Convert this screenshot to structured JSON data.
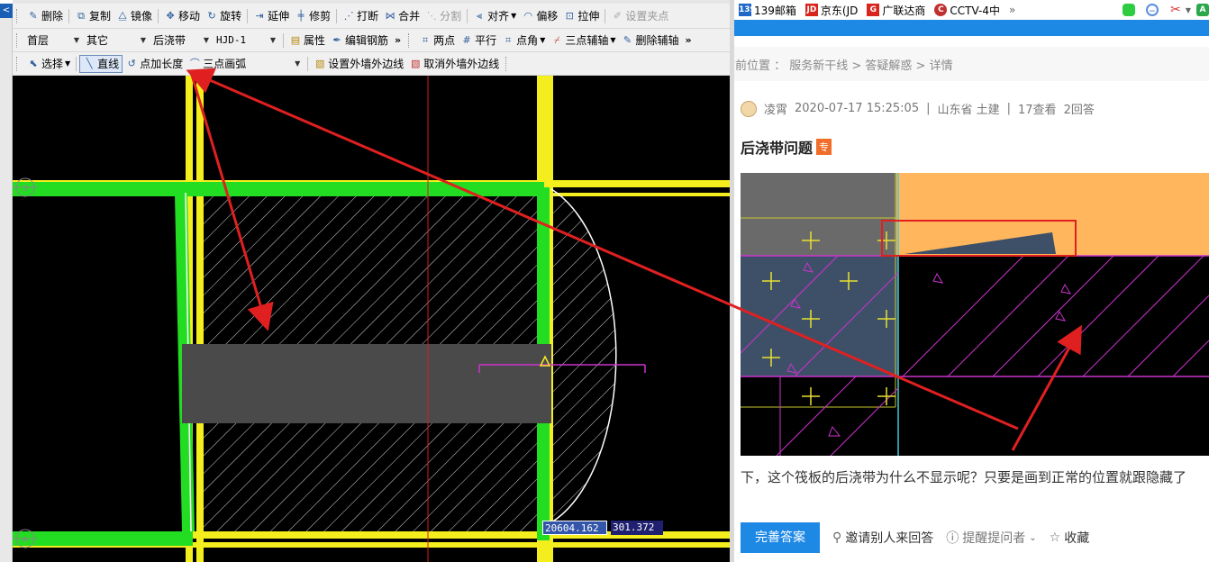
{
  "cad": {
    "left_tab": "<",
    "toolbar1": {
      "delete": "删除",
      "copy": "复制",
      "mirror": "镜像",
      "move": "移动",
      "rotate": "旋转",
      "extend": "延伸",
      "trim": "修剪",
      "break": "打断",
      "merge": "合并",
      "split": "分割",
      "align": "对齐",
      "offset": "偏移",
      "stretch": "拉伸",
      "set_grip": "设置夹点"
    },
    "toolbar2": {
      "floor": "首层",
      "category": "其它",
      "element_type": "后浇带",
      "element_name": "HJD-1",
      "properties": "属性",
      "edit_rebar": "编辑钢筋",
      "two_points": "两点",
      "parallel": "平行",
      "point_angle": "点角",
      "three_point_axis": "三点辅轴",
      "delete_axis": "删除辅轴"
    },
    "toolbar3": {
      "select": "选择",
      "line": "直线",
      "point_length": "点加长度",
      "three_point_arc": "三点画弧",
      "set_outer_edge": "设置外墙外边线",
      "cancel_outer_edge": "取消外墙外边线"
    },
    "coord_x": "20604.162",
    "coord_y": "301.372",
    "axis_marker_top": "3",
    "axis_marker_bottom": "A"
  },
  "browser": {
    "bookmarks": [
      "139邮箱",
      "京东(JD",
      "广联达商",
      "CCTV-4中"
    ],
    "more": "»",
    "bookmark_icons": [
      "139",
      "JD",
      "G",
      "C"
    ]
  },
  "page": {
    "breadcrumb": "前位置 ： 服务新干线 > 答疑解惑 > 详情",
    "author": "凌霄",
    "datetime": "2020-07-17 15:25:05",
    "location": "山东省  土建",
    "views": "17查看",
    "answers": "2回答",
    "question_title": "后浇带问题",
    "tag": "专",
    "question_text": "下，这个筏板的后浇带为什么不显示呢？只要是画到正常的位置就跟隐藏了",
    "action_answer": "完善答案",
    "action_invite": "邀请别人来回答",
    "action_remind": "提醒提问者",
    "action_favorite": "收藏"
  },
  "colors": {
    "cad_bg": "#000000",
    "wall_green": "#22dd22",
    "beam_yellow": "#f5ee1e",
    "band_gray": "#4a4a4a",
    "annotation_red": "#e02020",
    "accent_blue": "#1e88e5",
    "thumb_orange": "#ffb65c",
    "magenta": "#cc33cc"
  }
}
